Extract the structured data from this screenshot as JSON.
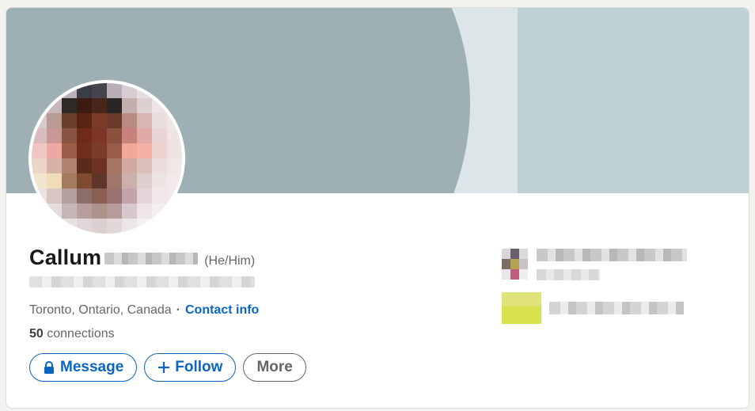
{
  "profile": {
    "first_name": "Callum",
    "pronouns": "(He/Him)",
    "location": "Toronto, Ontario, Canada",
    "separator": "·",
    "contact_label": "Contact info",
    "connections_count": "50",
    "connections_label": "connections"
  },
  "actions": {
    "message_label": "Message",
    "follow_label": "Follow",
    "more_label": "More"
  },
  "icons": {
    "message": "lock-icon",
    "follow": "plus-icon"
  },
  "colors": {
    "accent": "#0a66c2",
    "banner_dark": "#9eb0b4",
    "banner_light": "#c0d1d6"
  }
}
